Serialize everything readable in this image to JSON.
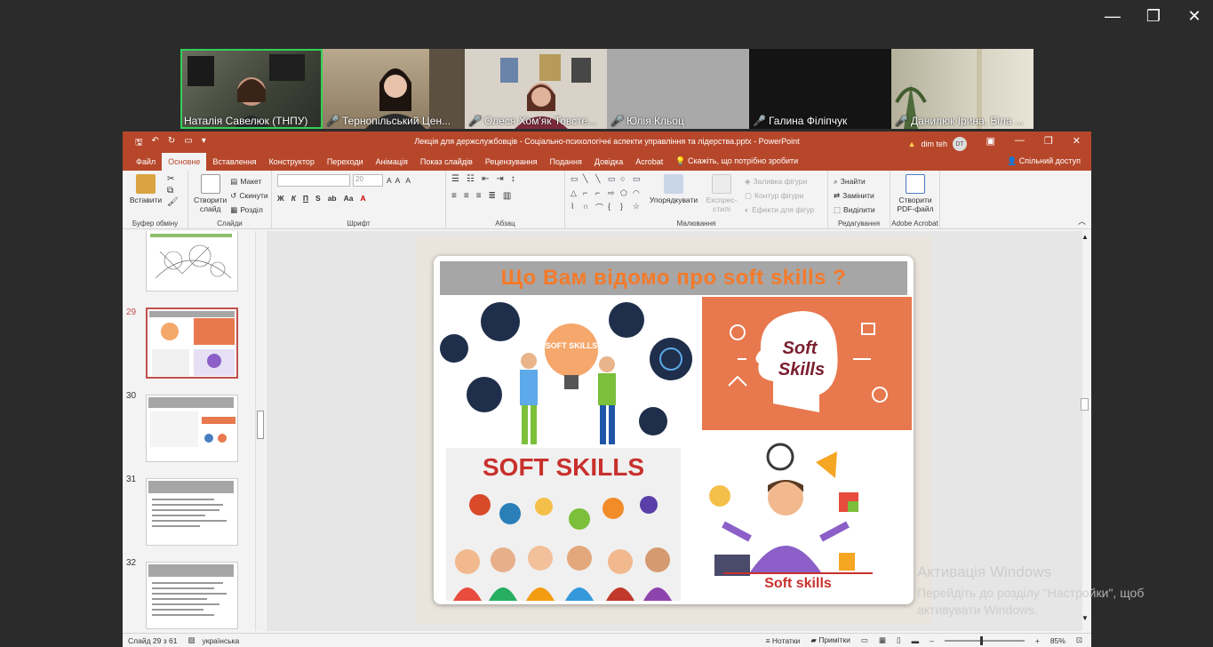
{
  "window_controls": {
    "minimize": "—",
    "restore": "❐",
    "close": "✕"
  },
  "participants": [
    {
      "name": "Наталія Савелюк (ТНПУ)",
      "muted": false
    },
    {
      "name": "Тернопільський Цен...",
      "muted": true
    },
    {
      "name": "Олеся Хом'як Товсте...",
      "muted": true
    },
    {
      "name": "Юлія Кльоц",
      "muted": true
    },
    {
      "name": "Галина Філіпчук",
      "muted": true
    },
    {
      "name": "Данилюк Ірина, Біла ...",
      "muted": true
    }
  ],
  "powerpoint": {
    "title": "Лекція для держслужбовців - Соціально-психологічні аспекти управління та лідерства.pptx  -  PowerPoint",
    "user": "dim teh",
    "user_initials": "DT",
    "menu_tabs": [
      "Файл",
      "Основне",
      "Вставлення",
      "Конструктор",
      "Переходи",
      "Анімація",
      "Показ слайдів",
      "Рецензування",
      "Подання",
      "Довідка",
      "Acrobat"
    ],
    "selected_tab": "Основне",
    "tell_me": "Скажіть, що потрібно зробити",
    "share": "Спільний доступ",
    "ribbon": {
      "clipboard": {
        "paste": "Вставити",
        "label": "Буфер обміну"
      },
      "slides": {
        "new_slide": "Створити слайд",
        "layout": "Макет",
        "reset": "Скинути",
        "section": "Розділ",
        "label": "Слайди"
      },
      "font": {
        "size": "20",
        "label": "Шрифт",
        "bold": "Ж",
        "italic": "К",
        "underline": "П",
        "strike": "S",
        "spacing": "ab",
        "case": "Aa",
        "clear": "A"
      },
      "paragraph": {
        "label": "Абзац"
      },
      "drawing": {
        "arrange": "Упорядкувати",
        "quick_styles": "Експрес-стилі",
        "fill": "Заливка фігури",
        "outline": "Контур фігури",
        "effects": "Ефекти для фігур",
        "label": "Малювання"
      },
      "editing": {
        "find": "Знайти",
        "replace": "Замінити",
        "select": "Виділити",
        "label": "Редагування"
      },
      "adobe": {
        "create_pdf": "Створити PDF-файл",
        "label": "Adobe Acrobat"
      }
    },
    "thumbnails": [
      {
        "num": "",
        "selected": false
      },
      {
        "num": "29",
        "selected": true
      },
      {
        "num": "30",
        "selected": false
      },
      {
        "num": "31",
        "selected": false
      },
      {
        "num": "32",
        "selected": false
      }
    ],
    "slide": {
      "title": "Що Вам відомо про soft skills ?",
      "q1_label": "SOFT SKILLS",
      "q2_label_1": "Soft",
      "q2_label_2": "Skills",
      "q3_label": "SOFT SKILLS",
      "q4_label": "Soft skills"
    },
    "status": {
      "slide_counter": "Слайд 29 з 61",
      "language": "українська",
      "notes": "Нотатки",
      "comments": "Примітки",
      "zoom": "85%"
    },
    "watermark": {
      "line1": "Активація Windows",
      "line2": "Перейдіть до розділу \"Настройки\", щоб",
      "line3": "активувати Windows."
    }
  }
}
